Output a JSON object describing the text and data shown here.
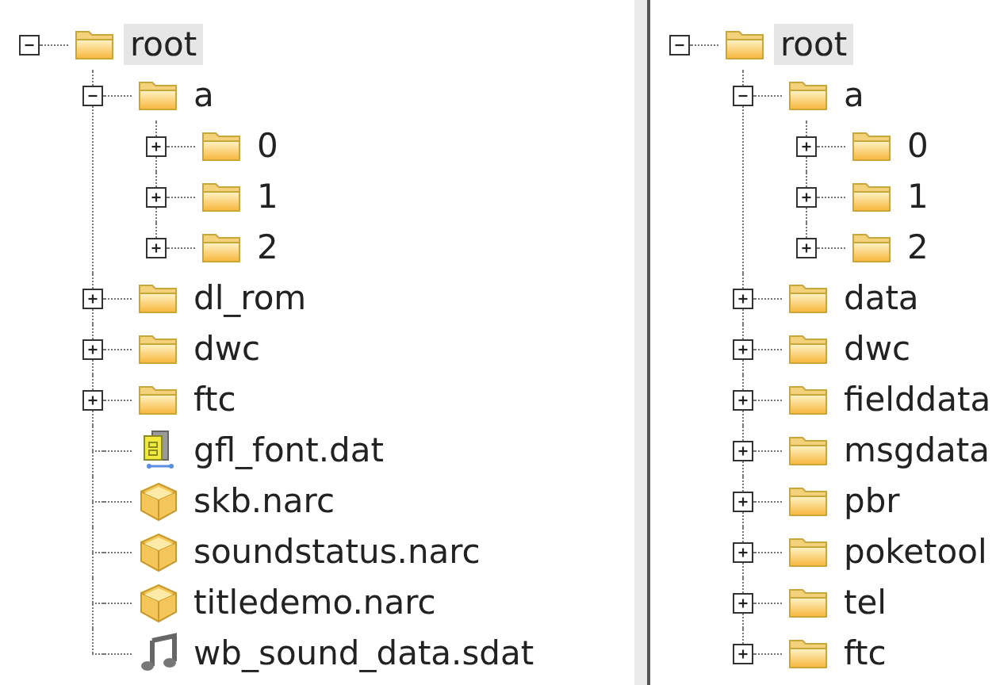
{
  "panes": [
    {
      "root": {
        "label": "root",
        "kind": "folder",
        "expanded": true,
        "selected": true,
        "children": [
          {
            "label": "a",
            "kind": "folder",
            "expanded": true,
            "selected": false,
            "children": [
              {
                "label": "0",
                "kind": "folder",
                "expanded": false,
                "selected": false
              },
              {
                "label": "1",
                "kind": "folder",
                "expanded": false,
                "selected": false
              },
              {
                "label": "2",
                "kind": "folder",
                "expanded": false,
                "selected": false
              }
            ]
          },
          {
            "label": "dl_rom",
            "kind": "folder",
            "expanded": false,
            "selected": false
          },
          {
            "label": "dwc",
            "kind": "folder",
            "expanded": false,
            "selected": false
          },
          {
            "label": "ftc",
            "kind": "folder",
            "expanded": false,
            "selected": false
          },
          {
            "label": "gfl_font.dat",
            "kind": "data",
            "selected": false
          },
          {
            "label": "skb.narc",
            "kind": "archive",
            "selected": false
          },
          {
            "label": "soundstatus.narc",
            "kind": "archive",
            "selected": false
          },
          {
            "label": "titledemo.narc",
            "kind": "archive",
            "selected": false
          },
          {
            "label": "wb_sound_data.sdat",
            "kind": "sound",
            "selected": false
          }
        ]
      }
    },
    {
      "root": {
        "label": "root",
        "kind": "folder",
        "expanded": true,
        "selected": true,
        "children": [
          {
            "label": "a",
            "kind": "folder",
            "expanded": true,
            "selected": false,
            "children": [
              {
                "label": "0",
                "kind": "folder",
                "expanded": false,
                "selected": false
              },
              {
                "label": "1",
                "kind": "folder",
                "expanded": false,
                "selected": false
              },
              {
                "label": "2",
                "kind": "folder",
                "expanded": false,
                "selected": false
              }
            ]
          },
          {
            "label": "data",
            "kind": "folder",
            "expanded": false,
            "selected": false
          },
          {
            "label": "dwc",
            "kind": "folder",
            "expanded": false,
            "selected": false
          },
          {
            "label": "fielddata",
            "kind": "folder",
            "expanded": false,
            "selected": false
          },
          {
            "label": "msgdata",
            "kind": "folder",
            "expanded": false,
            "selected": false
          },
          {
            "label": "pbr",
            "kind": "folder",
            "expanded": false,
            "selected": false
          },
          {
            "label": "poketool",
            "kind": "folder",
            "expanded": false,
            "selected": false
          },
          {
            "label": "tel",
            "kind": "folder",
            "expanded": false,
            "selected": false
          },
          {
            "label": "ftc",
            "kind": "folder",
            "expanded": false,
            "selected": false
          }
        ]
      }
    }
  ]
}
